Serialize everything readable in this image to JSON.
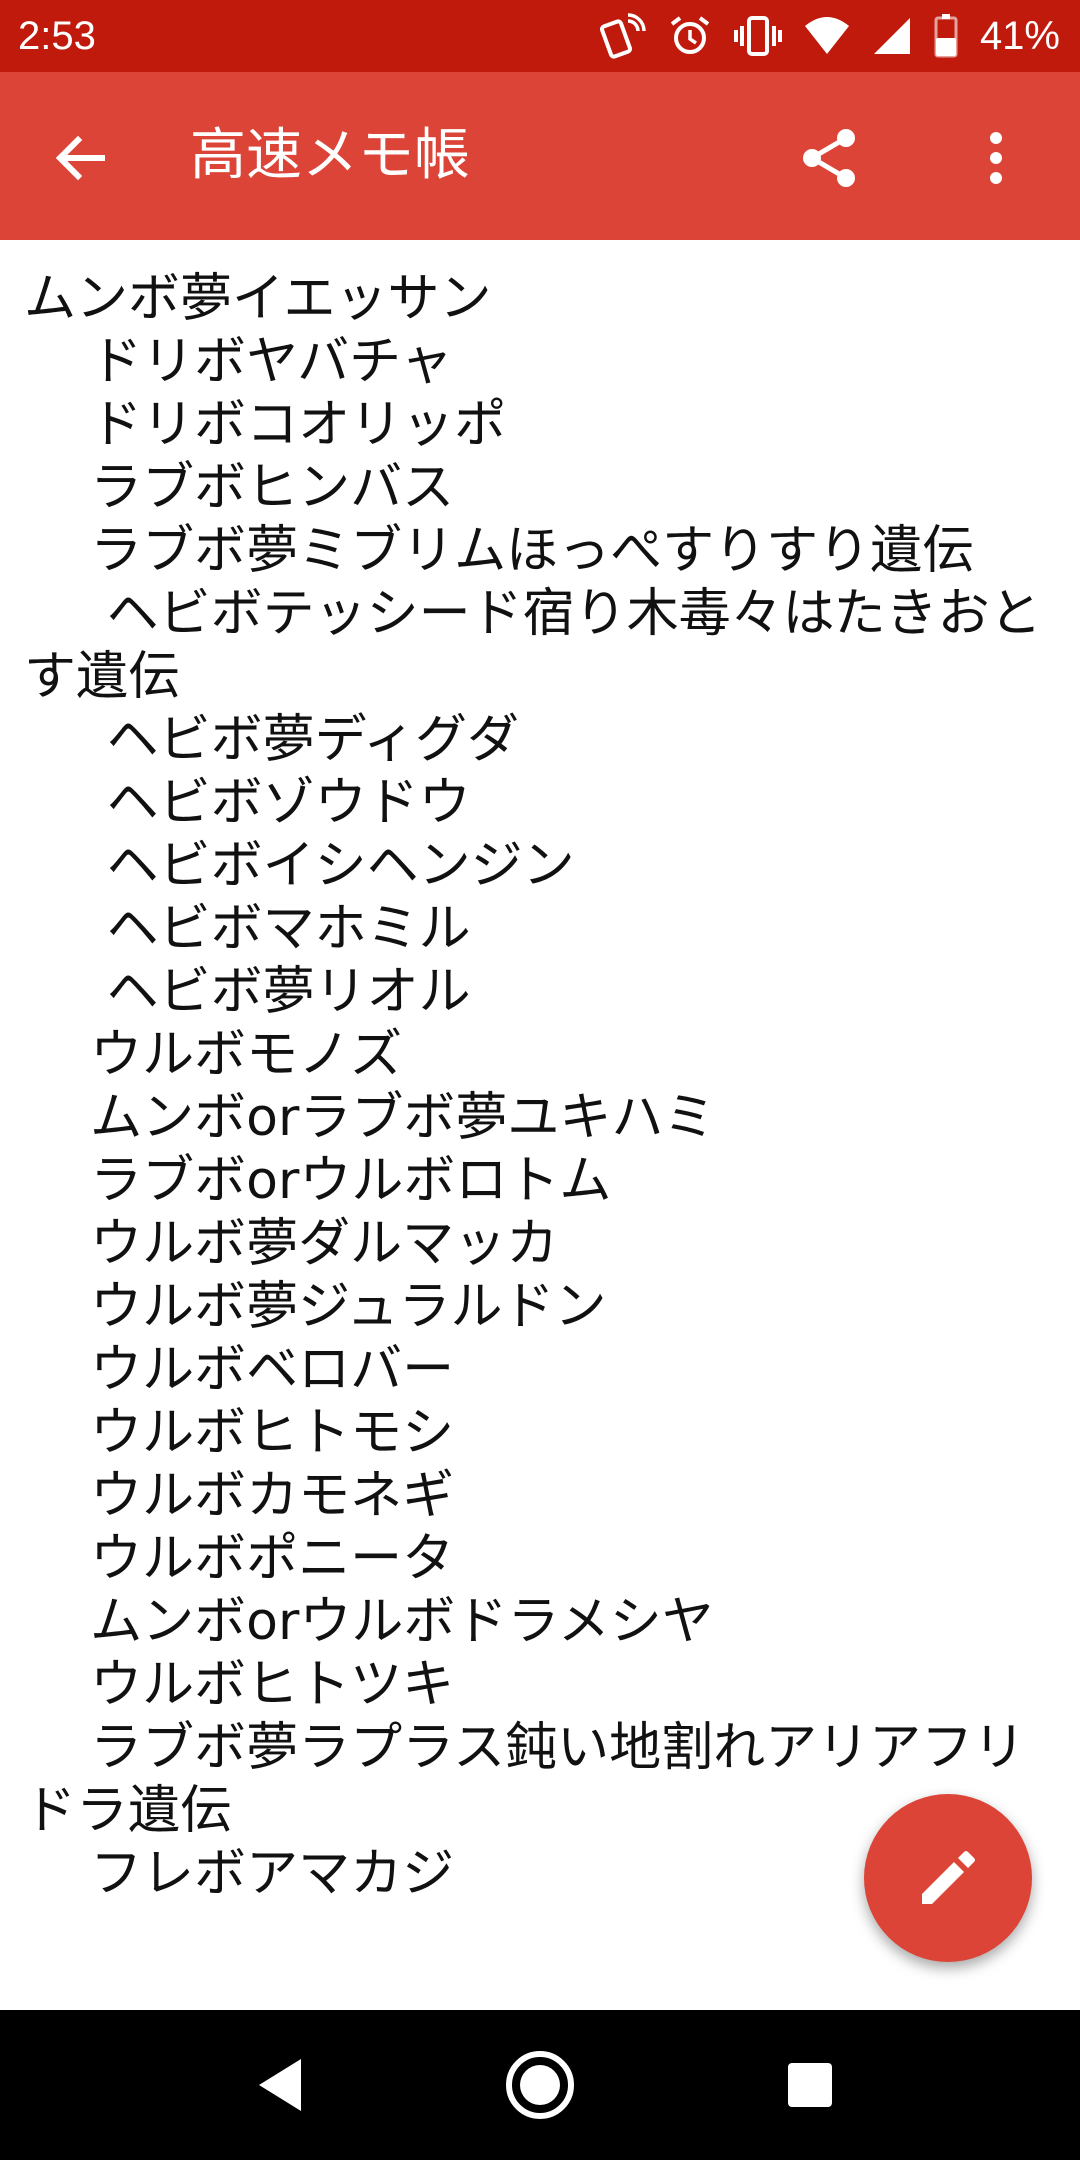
{
  "status_bar": {
    "time": "2:53",
    "battery_percent": "41%",
    "icons": [
      "nfc-phone-icon",
      "alarm-icon",
      "vibrate-icon",
      "wifi-icon",
      "signal-icon",
      "battery-icon"
    ]
  },
  "app_bar": {
    "title": "高速メモ帳",
    "color": "#db4437",
    "status_color": "#c01a0d"
  },
  "memo": {
    "text": "ムンボ夢イエッサン\n    ドリボヤバチャ\n    ドリボコオリッポ\n    ラブボヒンバス\n    ラブボ夢ミブリムほっぺすりすり遺伝\n     ヘビボテッシード宿り木毒々はたきおとす遺伝\n     ヘビボ夢ディグダ\n     ヘビボゾウドウ\n     ヘビボイシヘンジン\n     ヘビボマホミル\n     ヘビボ夢リオル\n    ウルボモノズ\n    ムンボorラブボ夢ユキハミ\n    ラブボorウルボロトム\n    ウルボ夢ダルマッカ\n    ウルボ夢ジュラルドン\n    ウルボベロバー\n    ウルボヒトモシ\n    ウルボカモネギ\n    ウルボポニータ\n    ムンボorウルボドラメシヤ\n    ウルボヒトツキ\n    ラブボ夢ラプラス鈍い地割れアリアフリドラ遺伝\n    フレボアマカジ"
  },
  "fab": {
    "icon": "pencil-edit-icon"
  },
  "nav_bar": {
    "icons": [
      "back-triangle-icon",
      "home-circle-icon",
      "recents-square-icon"
    ]
  }
}
